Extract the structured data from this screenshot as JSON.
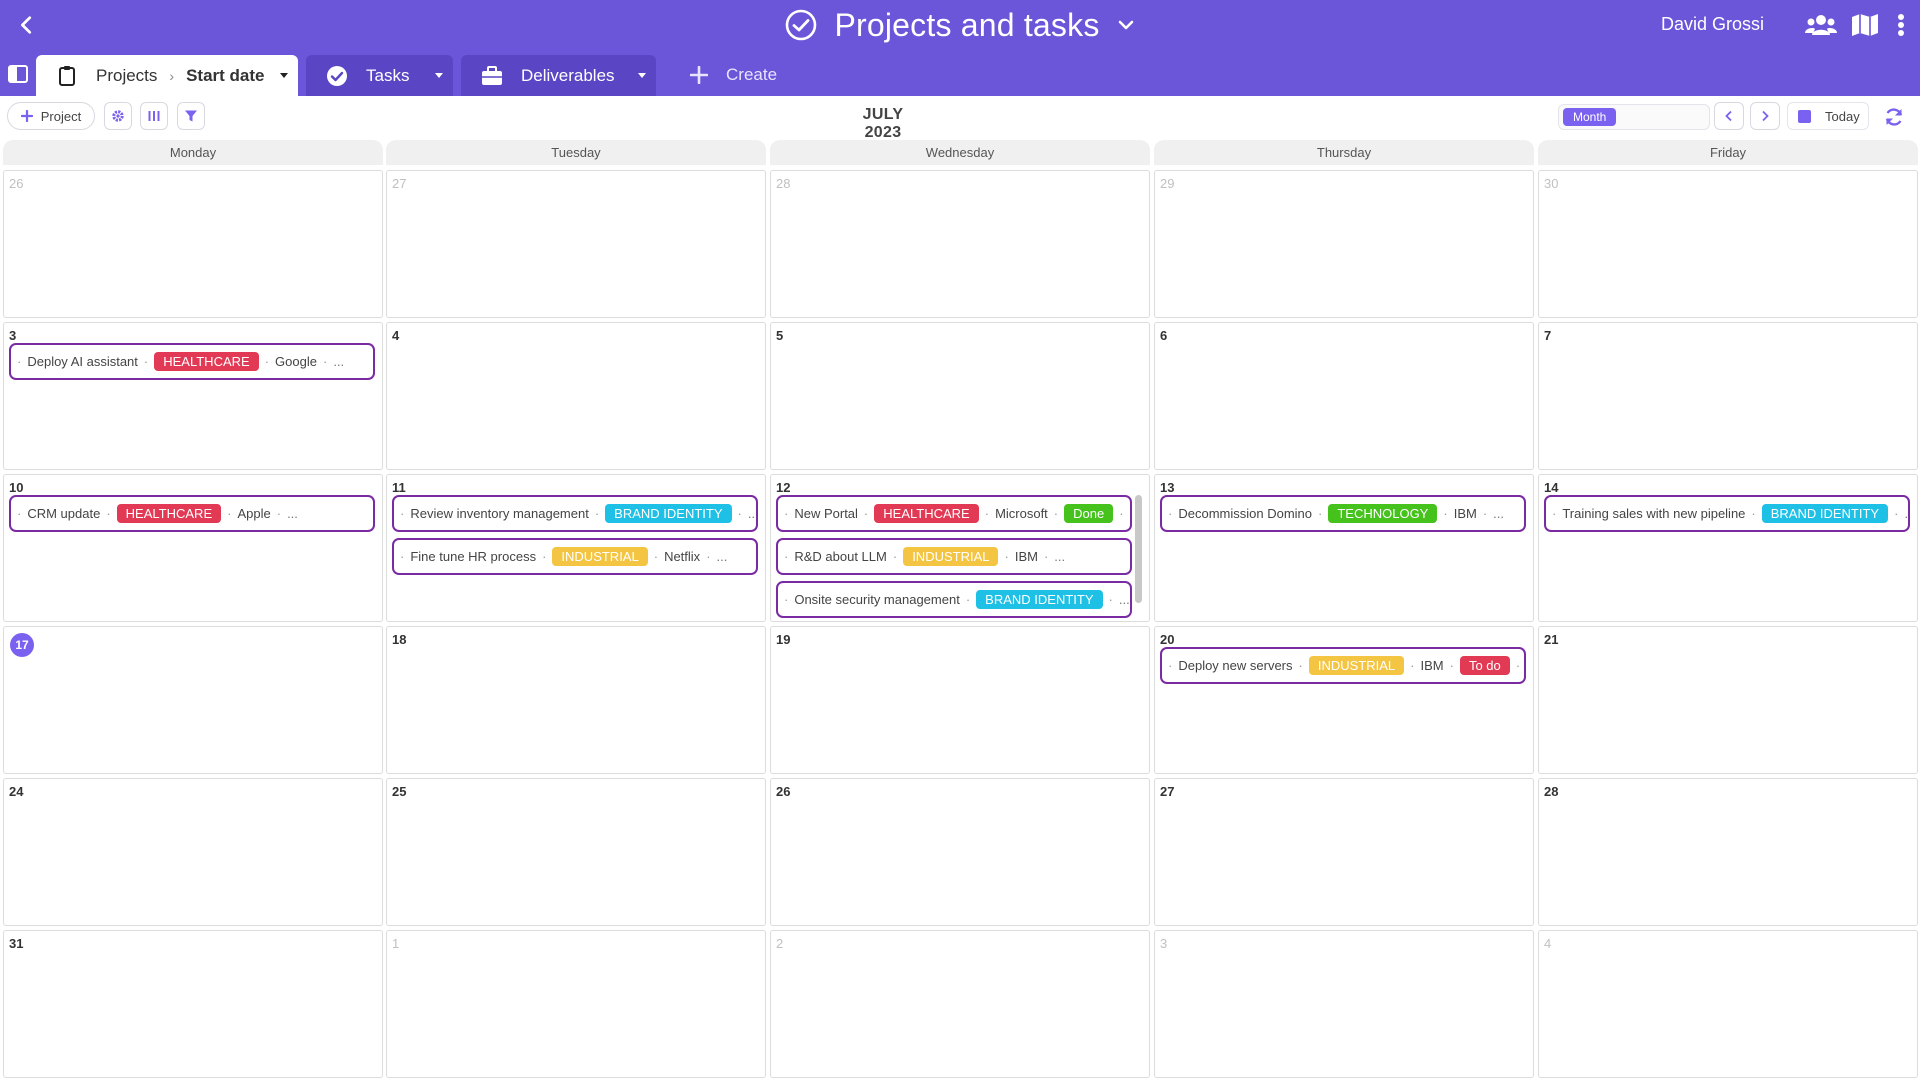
{
  "header": {
    "title": "Projects and tasks",
    "user_name": "David Grossi",
    "bg_color": "#6b55d9"
  },
  "tabs": {
    "projects": {
      "crumb1": "Projects",
      "crumb2": "Start date",
      "separator": "›"
    },
    "tasks": {
      "label": "Tasks"
    },
    "deliverables": {
      "label": "Deliverables"
    },
    "create": {
      "label": "Create"
    }
  },
  "toolbar": {
    "project_label": "Project",
    "month_label": "JULY 2023",
    "view_month": "Month",
    "today_label": "Today"
  },
  "weekdays": [
    "Monday",
    "Tuesday",
    "Wednesday",
    "Thursday",
    "Friday"
  ],
  "weeks": [
    {
      "days": [
        {
          "num": "26",
          "muted": true,
          "events": []
        },
        {
          "num": "27",
          "muted": true,
          "events": []
        },
        {
          "num": "28",
          "muted": true,
          "events": []
        },
        {
          "num": "29",
          "muted": true,
          "events": []
        },
        {
          "num": "30",
          "muted": true,
          "events": []
        }
      ]
    },
    {
      "days": [
        {
          "num": "3",
          "events": [
            {
              "title": "Deploy AI assistant",
              "tag": "HEALTHCARE",
              "tag_class": "healthcare",
              "company": "Google"
            }
          ]
        },
        {
          "num": "4",
          "events": []
        },
        {
          "num": "5",
          "events": []
        },
        {
          "num": "6",
          "events": []
        },
        {
          "num": "7",
          "events": []
        }
      ]
    },
    {
      "days": [
        {
          "num": "10",
          "events": [
            {
              "title": "CRM update",
              "tag": "HEALTHCARE",
              "tag_class": "healthcare",
              "company": "Apple"
            }
          ]
        },
        {
          "num": "11",
          "events": [
            {
              "title": "Review inventory management",
              "tag": "BRAND IDENTITY",
              "tag_class": "brand"
            },
            {
              "title": "Fine tune HR process",
              "tag": "INDUSTRIAL",
              "tag_class": "industrial",
              "company": "Netflix"
            }
          ]
        },
        {
          "num": "12",
          "scroll": true,
          "events": [
            {
              "title": "New Portal",
              "tag": "HEALTHCARE",
              "tag_class": "healthcare",
              "company": "Microsoft",
              "status": "Done",
              "status_class": "done"
            },
            {
              "title": "R&D about LLM",
              "tag": "INDUSTRIAL",
              "tag_class": "industrial",
              "company": "IBM"
            },
            {
              "title": "Onsite security management",
              "tag": "BRAND IDENTITY",
              "tag_class": "brand"
            }
          ]
        },
        {
          "num": "13",
          "events": [
            {
              "title": "Decommission Domino",
              "tag": "TECHNOLOGY",
              "tag_class": "tech",
              "company": "IBM"
            }
          ]
        },
        {
          "num": "14",
          "events": [
            {
              "title": "Training sales with new pipeline",
              "tag": "BRAND IDENTITY",
              "tag_class": "brand"
            }
          ]
        }
      ]
    },
    {
      "days": [
        {
          "num": "17",
          "today": true,
          "events": []
        },
        {
          "num": "18",
          "events": []
        },
        {
          "num": "19",
          "events": []
        },
        {
          "num": "20",
          "events": [
            {
              "title": "Deploy new servers",
              "tag": "INDUSTRIAL",
              "tag_class": "industrial",
              "company": "IBM",
              "status": "To do",
              "status_class": "todo"
            }
          ]
        },
        {
          "num": "21",
          "events": []
        }
      ]
    },
    {
      "days": [
        {
          "num": "24",
          "events": []
        },
        {
          "num": "25",
          "events": []
        },
        {
          "num": "26",
          "events": []
        },
        {
          "num": "27",
          "events": []
        },
        {
          "num": "28",
          "events": []
        }
      ]
    },
    {
      "days": [
        {
          "num": "31",
          "events": []
        },
        {
          "num": "1",
          "muted": true,
          "events": []
        },
        {
          "num": "2",
          "muted": true,
          "events": []
        },
        {
          "num": "3",
          "muted": true,
          "events": []
        },
        {
          "num": "4",
          "muted": true,
          "events": []
        }
      ]
    }
  ],
  "colors": {
    "accent": "#7b61ef",
    "event_border": "#7a2ba3",
    "healthcare": "#e23a55",
    "brand_identity": "#1ec0e6",
    "industrial": "#f4c542",
    "technology": "#45c21b"
  }
}
